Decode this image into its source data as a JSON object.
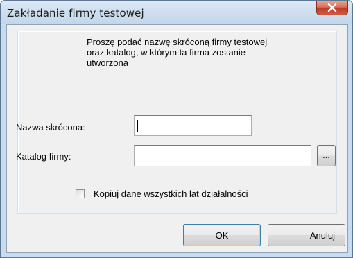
{
  "window": {
    "title": "Zakładanie firmy testowej"
  },
  "description": "Proszę podać nazwę skróconą firmy testowej\noraz katalog, w którym ta firma zostanie\nutworzona",
  "short_name": {
    "label": "Nazwa skrócona:",
    "value": ""
  },
  "catalog": {
    "label": "Katalog firmy:",
    "value": "",
    "browse_label": "..."
  },
  "copy_all_years": {
    "label": "Kopiuj dane wszystkich lat działalności",
    "checked": false
  },
  "buttons": {
    "ok_label": "OK",
    "cancel_label": "Anuluj"
  },
  "colors": {
    "close_button": "#c43a1f",
    "default_button_border": "#3c7fb1"
  }
}
